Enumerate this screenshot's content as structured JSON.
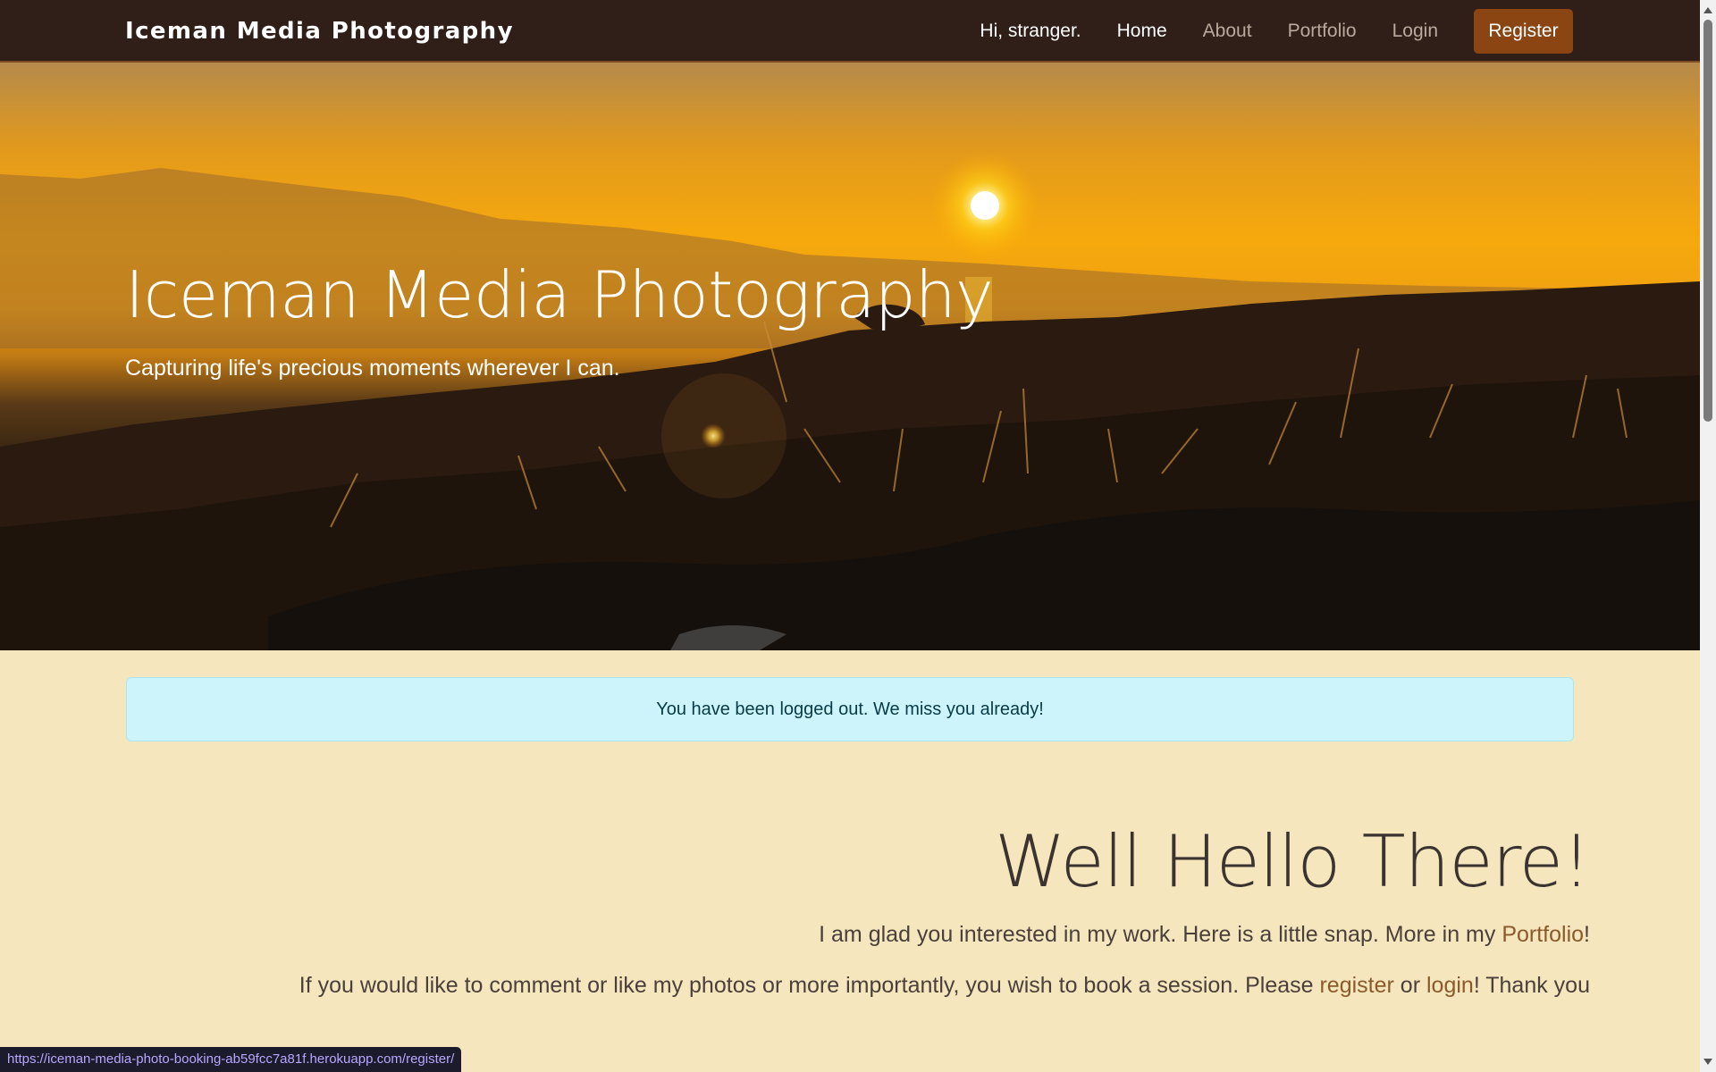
{
  "navbar": {
    "brand": "Iceman Media Photography",
    "greeting": "Hi, stranger.",
    "links": [
      {
        "label": "Home"
      },
      {
        "label": "About"
      },
      {
        "label": "Portfolio"
      },
      {
        "label": "Login"
      }
    ],
    "register_label": "Register"
  },
  "hero": {
    "title": "Iceman Media Photography",
    "subtitle": "Capturing life's precious moments wherever I can."
  },
  "alert": {
    "message": "You have been logged out. We miss you already!"
  },
  "welcome": {
    "title": "Well Hello There!",
    "line1_text": "I am glad you interested in my work. Here is a little snap. More in my ",
    "line1_link": "Portfolio",
    "line1_end": "!",
    "line2_text": "If you would like to comment or like my photos or more importantly, you wish to book a session. Please ",
    "line2_link1": "register",
    "line2_mid": " or ",
    "line2_link2": "login",
    "line2_end": "! Thank you"
  },
  "statusbar": {
    "url": "https://iceman-media-photo-booking-ab59fcc7a81f.herokuapp.com/register/"
  },
  "colors": {
    "navbar_bg": "#2f1f18",
    "register_btn": "#8b4513",
    "page_bg": "#f5e6bd",
    "alert_bg": "#cef4fb",
    "link": "#8b5a2b"
  }
}
